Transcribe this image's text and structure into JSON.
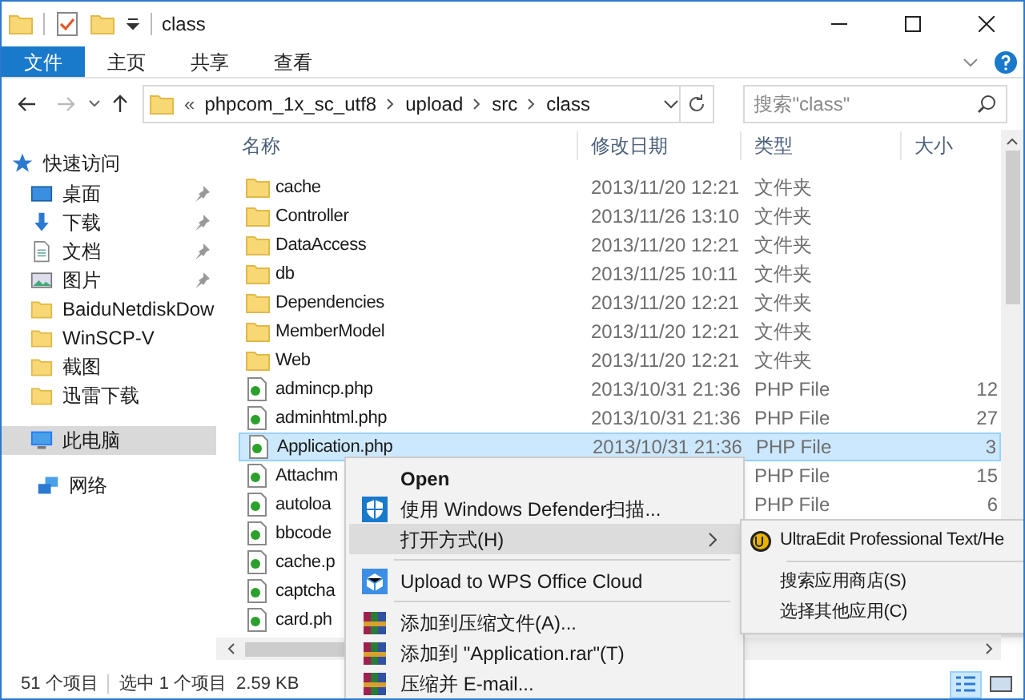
{
  "window": {
    "title": "class"
  },
  "ribbon_tabs": [
    {
      "label": "文件",
      "selected": true
    },
    {
      "label": "主页",
      "selected": false
    },
    {
      "label": "共享",
      "selected": false
    },
    {
      "label": "查看",
      "selected": false
    }
  ],
  "address_bar": {
    "overflow": "«",
    "path": [
      "phpcom_1x_sc_utf8",
      "upload",
      "src",
      "class"
    ]
  },
  "search": {
    "placeholder": "搜索\"class\""
  },
  "sidebar": {
    "items": [
      {
        "label": "快速访问",
        "kind": "star",
        "pinned": false,
        "selected": false
      },
      {
        "label": "桌面",
        "kind": "desktop",
        "pinned": true,
        "selected": false
      },
      {
        "label": "下载",
        "kind": "download",
        "pinned": true,
        "selected": false
      },
      {
        "label": "文档",
        "kind": "document",
        "pinned": true,
        "selected": false
      },
      {
        "label": "图片",
        "kind": "picture",
        "pinned": true,
        "selected": false
      },
      {
        "label": "BaiduNetdiskDow",
        "kind": "folder",
        "pinned": false,
        "selected": false
      },
      {
        "label": "WinSCP-V",
        "kind": "folder",
        "pinned": false,
        "selected": false
      },
      {
        "label": "截图",
        "kind": "folder",
        "pinned": false,
        "selected": false
      },
      {
        "label": "迅雷下载",
        "kind": "folder",
        "pinned": false,
        "selected": false
      },
      {
        "label": "此电脑",
        "kind": "pc",
        "pinned": false,
        "selected": true
      },
      {
        "label": "网络",
        "kind": "network",
        "pinned": false,
        "selected": false
      }
    ]
  },
  "columns": [
    "名称",
    "修改日期",
    "类型",
    "大小"
  ],
  "rows": [
    {
      "kind": "folder",
      "name": "cache",
      "date": "2013/11/20 12:21",
      "type": "文件夹",
      "selected": false
    },
    {
      "kind": "folder",
      "name": "Controller",
      "date": "2013/11/26 13:10",
      "type": "文件夹",
      "selected": false
    },
    {
      "kind": "folder",
      "name": "DataAccess",
      "date": "2013/11/20 12:21",
      "type": "文件夹",
      "selected": false
    },
    {
      "kind": "folder",
      "name": "db",
      "date": "2013/11/25 10:11",
      "type": "文件夹",
      "selected": false
    },
    {
      "kind": "folder",
      "name": "Dependencies",
      "date": "2013/11/20 12:21",
      "type": "文件夹",
      "selected": false
    },
    {
      "kind": "folder",
      "name": "MemberModel",
      "date": "2013/11/20 12:21",
      "type": "文件夹",
      "selected": false
    },
    {
      "kind": "folder",
      "name": "Web",
      "date": "2013/11/20 12:21",
      "type": "文件夹",
      "selected": false
    },
    {
      "kind": "php",
      "name": "admincp.php",
      "date": "2013/10/31 21:36",
      "type": "PHP File",
      "size": "12",
      "selected": false
    },
    {
      "kind": "php",
      "name": "adminhtml.php",
      "date": "2013/10/31 21:36",
      "type": "PHP File",
      "size": "27",
      "selected": false
    },
    {
      "kind": "php",
      "name": "Application.php",
      "date": "2013/10/31 21:36",
      "type": "PHP File",
      "size": "3",
      "selected": true
    },
    {
      "kind": "php",
      "name": "Attachm",
      "type": "PHP File",
      "size": "15",
      "selected": false
    },
    {
      "kind": "php",
      "name": "autoloa",
      "type": "PHP File",
      "size": "6",
      "selected": false
    },
    {
      "kind": "php",
      "name": "bbcode",
      "selected": false
    },
    {
      "kind": "php",
      "name": "cache.p",
      "selected": false
    },
    {
      "kind": "php",
      "name": "captcha",
      "selected": false
    },
    {
      "kind": "php",
      "name": "card.ph",
      "selected": false
    }
  ],
  "context_menu": {
    "items": [
      {
        "kind": "plain",
        "label": "Open",
        "bold": true,
        "highlighted": false
      },
      {
        "kind": "defender",
        "label": "使用 Windows Defender扫描...",
        "bold": false,
        "highlighted": false
      },
      {
        "kind": "submenu",
        "label": "打开方式(H)",
        "bold": false,
        "highlighted": true
      },
      {
        "kind": "separator"
      },
      {
        "kind": "wps",
        "label": "Upload to WPS Office Cloud",
        "bold": false,
        "highlighted": false
      },
      {
        "kind": "separator"
      },
      {
        "kind": "rar",
        "label": "添加到压缩文件(A)...",
        "bold": false,
        "highlighted": false
      },
      {
        "kind": "rar",
        "label": "添加到 \"Application.rar\"(T)",
        "bold": false,
        "highlighted": false
      },
      {
        "kind": "rar",
        "label": "压缩并 E-mail...",
        "bold": false,
        "highlighted": false
      }
    ]
  },
  "submenu": {
    "items": [
      {
        "kind": "app",
        "label": "UltraEdit Professional Text/He"
      },
      {
        "kind": "separator"
      },
      {
        "kind": "plain",
        "label": "搜索应用商店(S)"
      },
      {
        "kind": "plain",
        "label": "选择其他应用(C)"
      }
    ]
  },
  "status_bar": {
    "item_count": "51 个项目",
    "selection": "选中 1 个项目",
    "size": "2.59 KB"
  },
  "view_buttons": [
    {
      "kind": "details",
      "selected": true
    },
    {
      "kind": "thumbnails",
      "selected": false
    }
  ]
}
